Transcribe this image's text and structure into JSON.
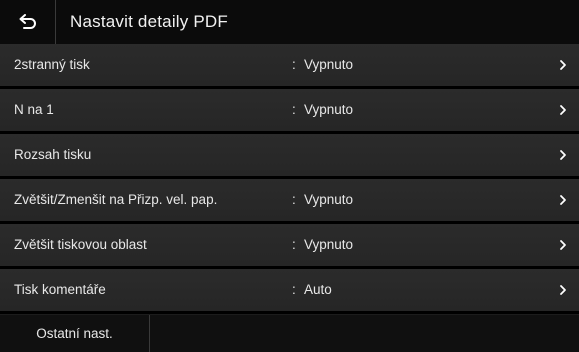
{
  "header": {
    "title": "Nastavit detaily PDF",
    "back_icon": "back-arrow-icon"
  },
  "settings": [
    {
      "label": "2stranný tisk",
      "colon": ":",
      "value": "Vypnuto"
    },
    {
      "label": "N na 1",
      "colon": ":",
      "value": "Vypnuto"
    },
    {
      "label": "Rozsah tisku",
      "colon": "",
      "value": ""
    },
    {
      "label": "Zvětšit/Zmenšit na Přizp. vel. pap.",
      "colon": ":",
      "value": "Vypnuto"
    },
    {
      "label": "Zvětšit tiskovou oblast",
      "colon": ":",
      "value": "Vypnuto"
    },
    {
      "label": "Tisk komentáře",
      "colon": ":",
      "value": "Auto"
    }
  ],
  "footer": {
    "other_settings_label": "Ostatní nast."
  },
  "colors": {
    "background": "#111111",
    "row": "#2a2a2a",
    "text": "#e8e8e8"
  }
}
